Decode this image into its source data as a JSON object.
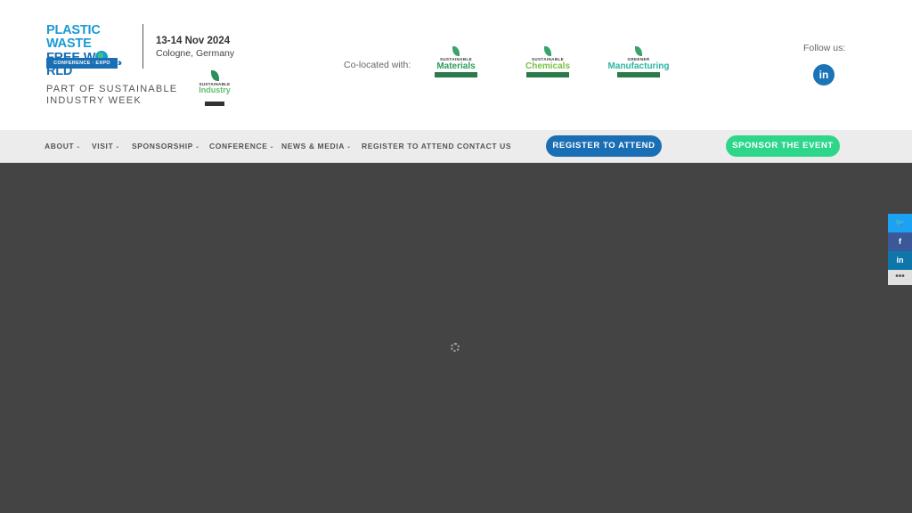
{
  "header": {
    "logo": {
      "line1": "PLASTIC WASTE",
      "line2_a": "FREE W",
      "line2_b": "RLD",
      "bar": "CONFERENCE · EXPO"
    },
    "dates": "13-14 Nov 2024",
    "location": "Cologne, Germany",
    "part_of": "PART OF SUSTAINABLE INDUSTRY WEEK",
    "siw_logo": {
      "small": "SUSTAINABLE",
      "big": "Industry"
    },
    "colocated_label": "Co-located with:",
    "partners": [
      {
        "small": "SUSTAINABLE",
        "big": "Materials",
        "color": "#2a9d5c"
      },
      {
        "small": "SUSTAINABLE",
        "big": "Chemicals",
        "color": "#7bc043"
      },
      {
        "small": "GREENER",
        "big": "Manufacturing",
        "color": "#2bb3a0"
      }
    ],
    "follow_label": "Follow us:",
    "linkedin_icon": "in"
  },
  "nav": {
    "items": [
      {
        "label": "ABOUT",
        "dropdown": true
      },
      {
        "label": "VISIT",
        "dropdown": true
      },
      {
        "label": "SPONSORSHIP",
        "dropdown": true
      },
      {
        "label": "CONFERENCE",
        "dropdown": true
      },
      {
        "label": "NEWS & MEDIA",
        "dropdown": true
      },
      {
        "label": "REGISTER TO ATTEND",
        "dropdown": false
      },
      {
        "label": "CONTACT US",
        "dropdown": false
      }
    ],
    "register_button": "REGISTER TO ATTEND",
    "sponsor_button": "SPONSOR THE EVENT"
  },
  "share_bar": {
    "twitter": "🐦",
    "facebook": "f",
    "linkedin": "in",
    "more": "•••"
  },
  "colors": {
    "brand_blue": "#1a6fb4",
    "sponsor_green": "#2ed68a",
    "content_bg": "#444444"
  }
}
